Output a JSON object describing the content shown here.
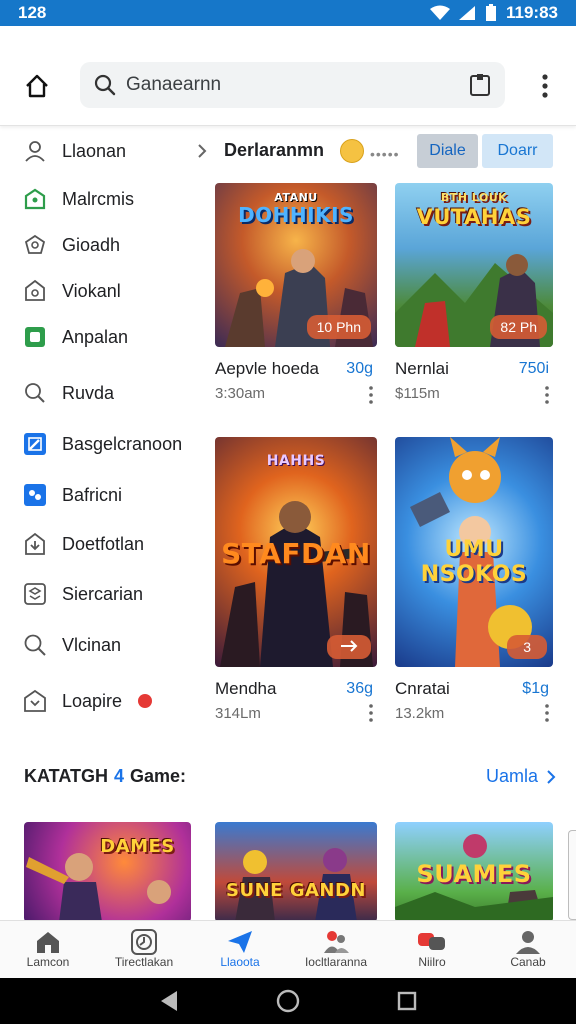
{
  "status_bar": {
    "time_left": "128",
    "time_right": "119:83"
  },
  "search": {
    "text": "Ganaearnn"
  },
  "sidebar": {
    "items": [
      {
        "label": "Llaonan",
        "icon": "person-icon"
      },
      {
        "label": "Malrcmis",
        "icon": "bag-icon"
      },
      {
        "label": "Gioadh",
        "icon": "gamepad-icon"
      },
      {
        "label": "Viokanl",
        "icon": "shield-icon"
      },
      {
        "label": "Anpalan",
        "icon": "square-app-icon"
      },
      {
        "label": "Ruvda",
        "icon": "search-people-icon"
      },
      {
        "label": "Basgelcranoon",
        "icon": "edit-box-icon"
      },
      {
        "label": "Bafricni",
        "icon": "puzzle-icon"
      },
      {
        "label": "Doetfotlan",
        "icon": "download-house-icon"
      },
      {
        "label": "Siercarian",
        "icon": "layers-icon"
      },
      {
        "label": "Vlcinan",
        "icon": "magnifier-icon"
      },
      {
        "label": "Loapire",
        "icon": "home-outline-icon"
      }
    ]
  },
  "section": {
    "title": "Derlaranmn",
    "filter_1": "Diale",
    "filter_2": "Doarr"
  },
  "cards": [
    {
      "art_title": "DOHHIKIS",
      "art_sub": "ATANU",
      "tag": "10 Phn",
      "title": "Aepvle hoeda",
      "price": "30g",
      "sub": "3:30am"
    },
    {
      "art_title": "VUTAHAS",
      "art_sub": "BTH LOUK",
      "tag": "82 Ph",
      "title": "Nernlai",
      "price": "750i",
      "sub": "$115m"
    },
    {
      "art_title": "STAFDAN",
      "art_sub": "HAHHS",
      "tag": "",
      "title": "Mendha",
      "price": "36g",
      "sub": "314Lm"
    },
    {
      "art_title": "UMU NSOKOS",
      "art_sub": "",
      "tag": "3",
      "title": "Cnratai",
      "price": "$1g",
      "sub": "13.2km"
    }
  ],
  "games": {
    "prefix": "KATATGH",
    "number": "4",
    "label": "Game:",
    "more": "Uamla"
  },
  "bottom_cards": [
    {
      "art_title": "DAMES"
    },
    {
      "art_title": "SUNE GANDN"
    },
    {
      "art_title": "SUAMES"
    }
  ],
  "bottom_nav": [
    {
      "label": "Lamcon",
      "icon": "house-icon"
    },
    {
      "label": "Tirectlakan",
      "icon": "clock-icon"
    },
    {
      "label": "Llaoota",
      "icon": "paper-plane-icon"
    },
    {
      "label": "Iocltlaranna",
      "icon": "group-icon"
    },
    {
      "label": "Niilro",
      "icon": "chat-icon"
    },
    {
      "label": "Canab",
      "icon": "profile-icon"
    }
  ],
  "colors": {
    "accent": "#1a73e8",
    "status_bar": "#1677c9",
    "tag": "#d65c34"
  }
}
